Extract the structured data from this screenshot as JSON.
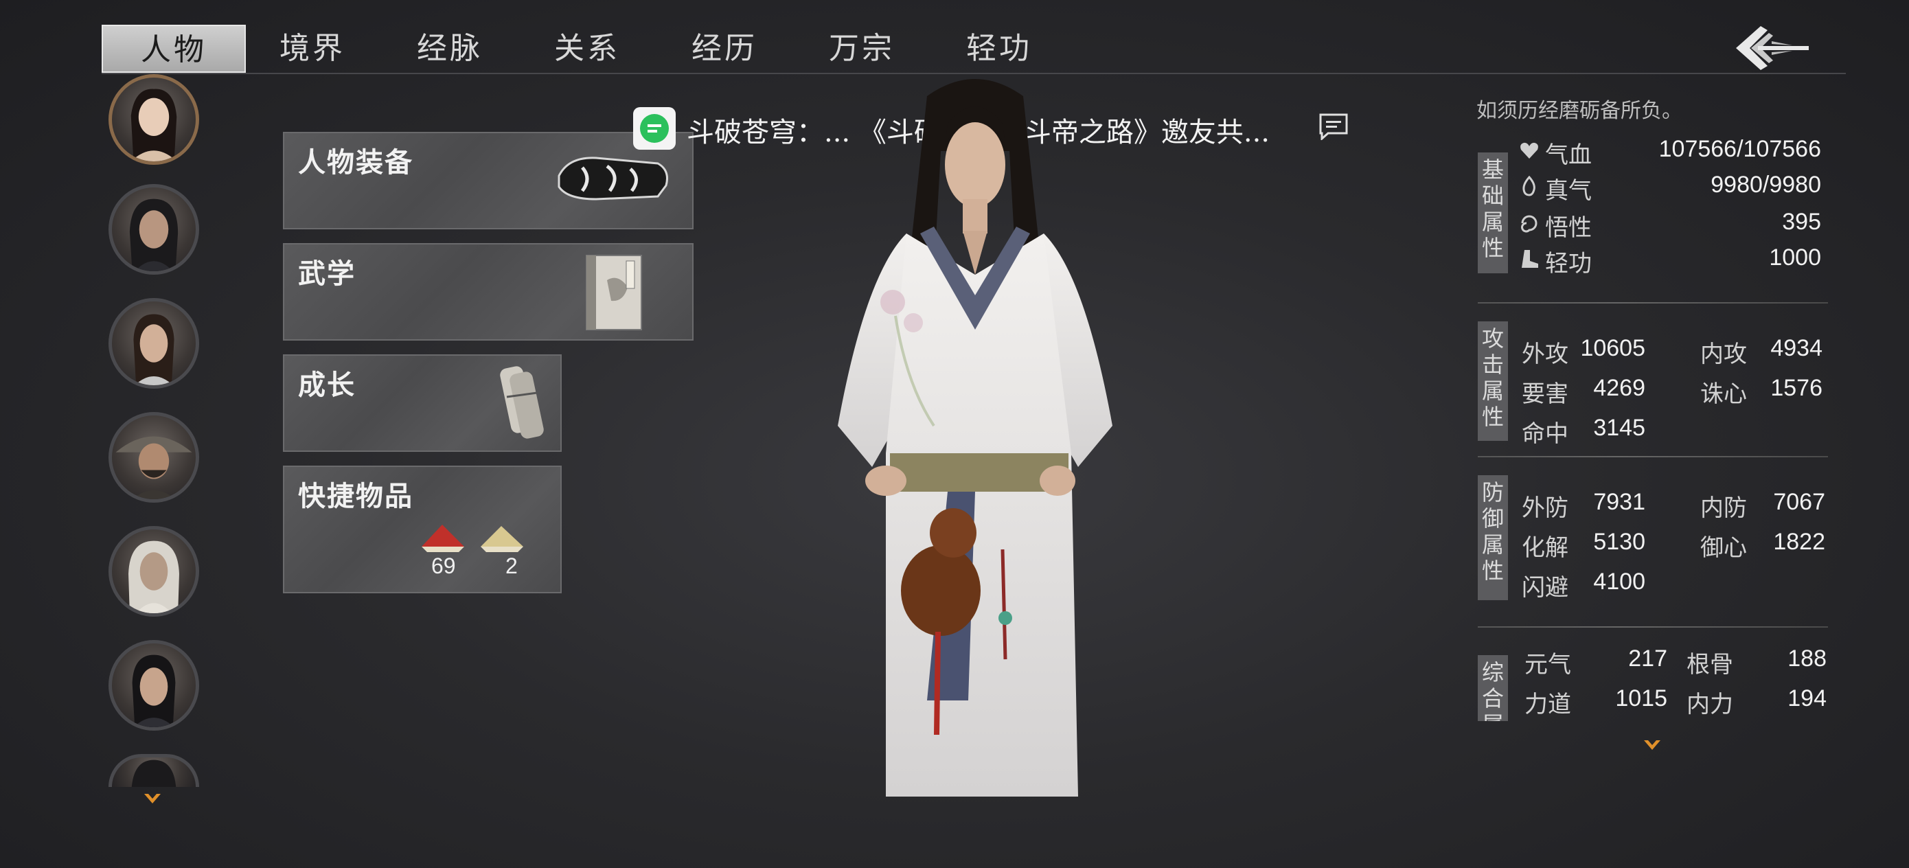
{
  "tabs": [
    {
      "label": "人物",
      "active": true
    },
    {
      "label": "境界"
    },
    {
      "label": "经脉"
    },
    {
      "label": "关系"
    },
    {
      "label": "经历"
    },
    {
      "label": "万宗"
    },
    {
      "label": "轻功"
    }
  ],
  "menu": {
    "equipment": "人物装备",
    "martial": "武学",
    "growth": "成长",
    "quick_items": "快捷物品",
    "quick_item_counts": [
      "69",
      "2"
    ]
  },
  "chat": {
    "text": "斗破苍穹：... 《斗破苍穹：斗帝之路》邀友共..."
  },
  "stats": {
    "top_text": "如须历经磨砺备所负。",
    "basic": {
      "tag": "基础属性",
      "hp_label": "气血",
      "hp_value": "107566/107566",
      "qi_label": "真气",
      "qi_value": "9980/9980",
      "wisdom_label": "悟性",
      "wisdom_value": "395",
      "qinggong_label": "轻功",
      "qinggong_value": "1000"
    },
    "attack": {
      "tag": "攻击属性",
      "ext_atk_label": "外攻",
      "ext_atk_value": "10605",
      "int_atk_label": "内攻",
      "int_atk_value": "4934",
      "vital_label": "要害",
      "vital_value": "4269",
      "heart_label": "诛心",
      "heart_value": "1576",
      "hit_label": "命中",
      "hit_value": "3145"
    },
    "defense": {
      "tag": "防御属性",
      "ext_def_label": "外防",
      "ext_def_value": "7931",
      "int_def_label": "内防",
      "int_def_value": "7067",
      "dissolve_label": "化解",
      "dissolve_value": "5130",
      "guard_label": "御心",
      "guard_value": "1822",
      "dodge_label": "闪避",
      "dodge_value": "4100"
    },
    "general": {
      "tag": "综合属",
      "vitality_label": "元气",
      "vitality_value": "217",
      "bone_label": "根骨",
      "bone_value": "188",
      "strength_label": "力道",
      "strength_value": "1015",
      "inner_label": "内力",
      "inner_value": "194"
    }
  },
  "colors": {
    "background": "#2a2a2d",
    "panel": "#505052",
    "chat_green": "#2bc05c",
    "scroll_arrow": "#e0902a"
  }
}
